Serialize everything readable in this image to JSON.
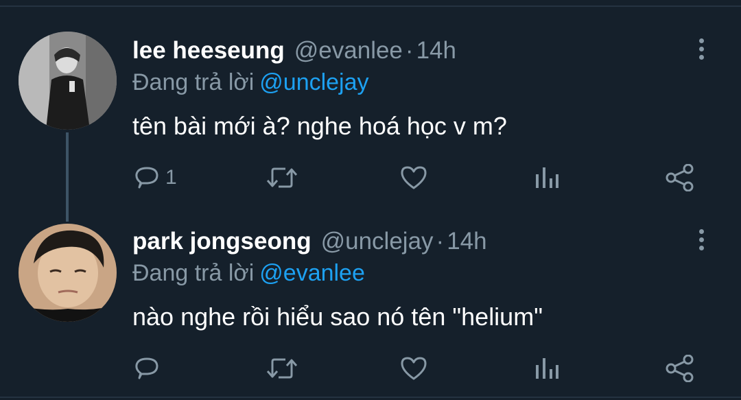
{
  "tweets": [
    {
      "display_name": "lee heeseung",
      "handle": "@evanlee",
      "separator": "·",
      "time": "14h",
      "reply_prefix": "Đang trả lời",
      "reply_to": "@unclejay",
      "text": "tên bài mới à? nghe hoá học v m?",
      "reply_count": "1",
      "avatar_icon": "profile-photo",
      "more_icon": "vertical-ellipsis-icon"
    },
    {
      "display_name": "park jongseong",
      "handle": "@unclejay",
      "separator": "·",
      "time": "14h",
      "reply_prefix": "Đang trả lời",
      "reply_to": "@evanlee",
      "text": "nào nghe rồi hiểu sao nó tên \"helium\"",
      "reply_count": "",
      "avatar_icon": "profile-photo",
      "more_icon": "vertical-ellipsis-icon"
    }
  ],
  "colors": {
    "background": "#15202b",
    "text_primary": "#ffffff",
    "text_secondary": "#8899a6",
    "accent": "#1da1f2",
    "thread_line": "#3d5466"
  },
  "action_icons": [
    "reply-icon",
    "retweet-icon",
    "like-icon",
    "analytics-icon",
    "share-icon"
  ]
}
